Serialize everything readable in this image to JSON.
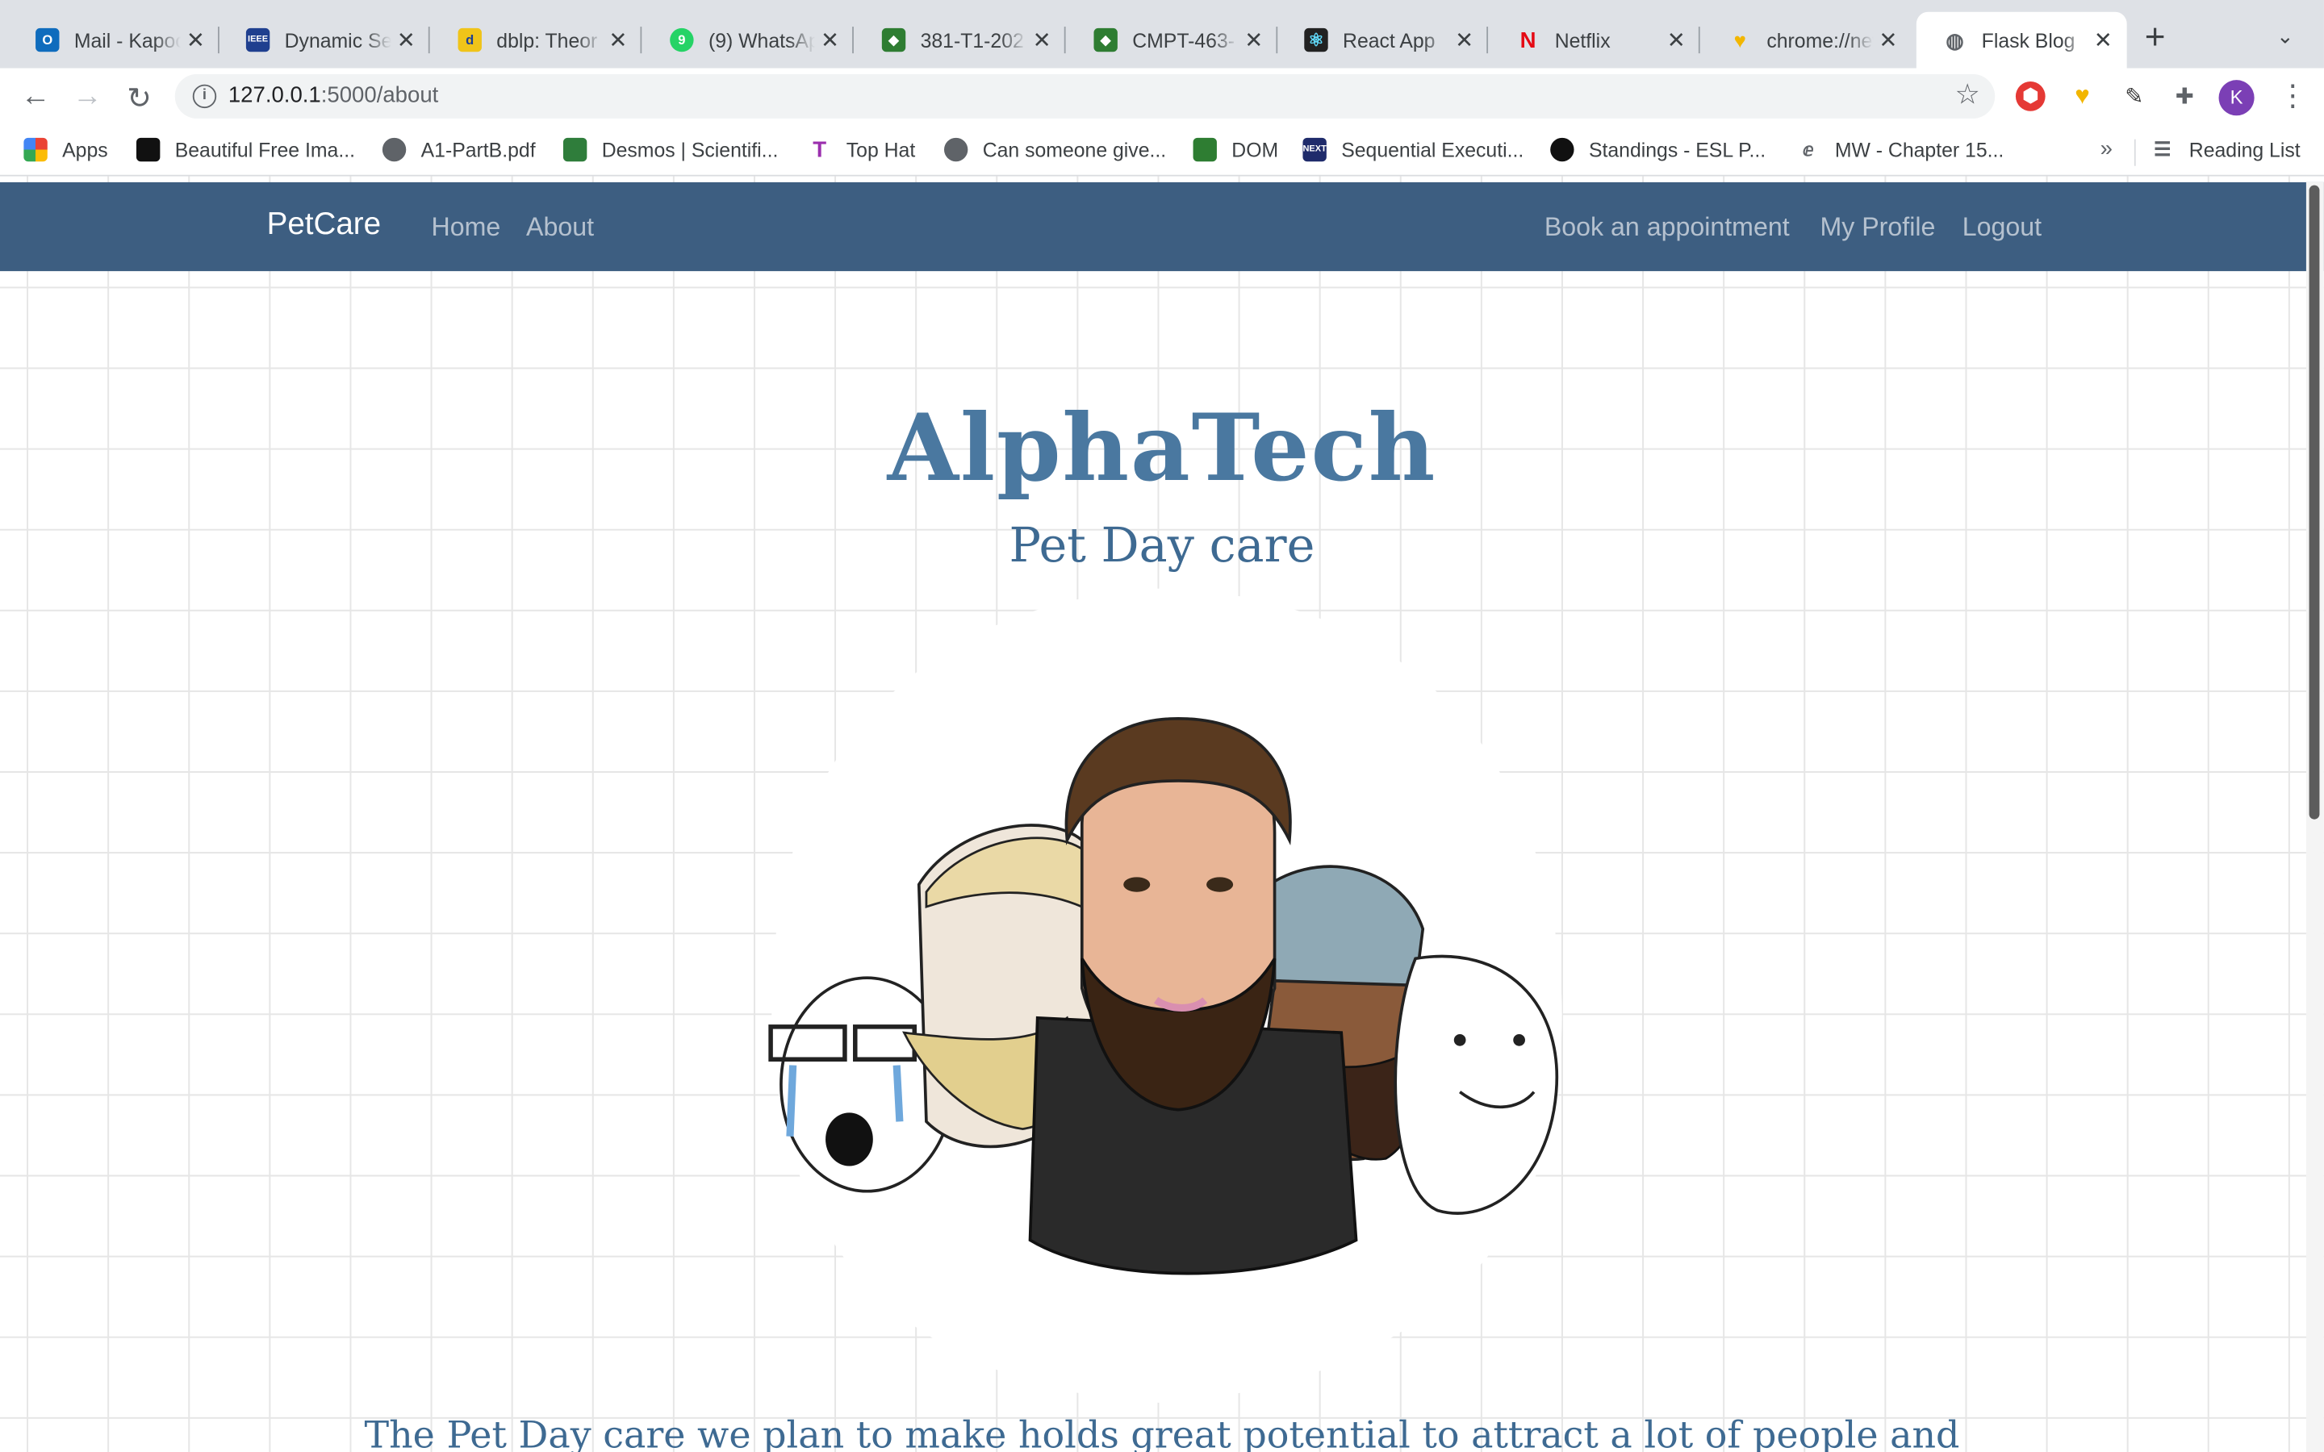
{
  "browser": {
    "tabs": [
      {
        "title": "Mail - Kapoor",
        "icon_color": "#0f6cbd",
        "icon_glyph": "O"
      },
      {
        "title": "Dynamic Se",
        "icon_color": "#1f3f8f",
        "icon_glyph": "IEEE"
      },
      {
        "title": "dblp: Theor",
        "icon_color": "#1c3f95",
        "icon_glyph": "d"
      },
      {
        "title": "(9) WhatsAp",
        "icon_color": "#25d366",
        "icon_glyph": "9"
      },
      {
        "title": "381-T1-202",
        "icon_color": "#2e7d32",
        "icon_glyph": "◆"
      },
      {
        "title": "CMPT-463-",
        "icon_color": "#2e7d32",
        "icon_glyph": "◆"
      },
      {
        "title": "React App",
        "icon_color": "#222222",
        "icon_glyph": "⚛"
      },
      {
        "title": "Netflix",
        "icon_color": "#e50914",
        "icon_glyph": "N"
      },
      {
        "title": "chrome://new",
        "icon_color": "#f2b600",
        "icon_glyph": "♥"
      },
      {
        "title": "Flask Blog",
        "icon_color": "#5f6368",
        "icon_glyph": "◍"
      }
    ],
    "active_tab_index": 9,
    "url_host": "127.0.0.1",
    "url_path": ":5000/about",
    "profile_initial": "K",
    "bookmarks": [
      {
        "label": "Apps",
        "icon_color": "#ea4335"
      },
      {
        "label": "Beautiful Free Ima...",
        "icon_color": "#111111"
      },
      {
        "label": "A1-PartB.pdf",
        "icon_color": "#5f6368"
      },
      {
        "label": "Desmos | Scientifi...",
        "icon_color": "#2f7d3b"
      },
      {
        "label": "Top Hat",
        "icon_color": "#9b2fae"
      },
      {
        "label": "Can someone give...",
        "icon_color": "#5f6368"
      },
      {
        "label": "DOM",
        "icon_color": "#2e7d32"
      },
      {
        "label": "Sequential Executi...",
        "icon_color": "#1f2b6b"
      },
      {
        "label": "Standings - ESL P...",
        "icon_color": "#111111"
      },
      {
        "label": "MW - Chapter 15...",
        "icon_color": "#5f6368"
      }
    ],
    "more_bookmarks": "»",
    "reading_list": "Reading List"
  },
  "site": {
    "brand": "PetCare",
    "nav_left": [
      "Home",
      "About"
    ],
    "nav_right": [
      "Book an appointment",
      "My Profile",
      "Logout"
    ],
    "nav_color": "#3d5e81",
    "title": "AlphaTech",
    "subtitle": "Pet Day care",
    "intro_text": "The Pet Day care we plan to make holds great potential to attract a lot of people and"
  }
}
